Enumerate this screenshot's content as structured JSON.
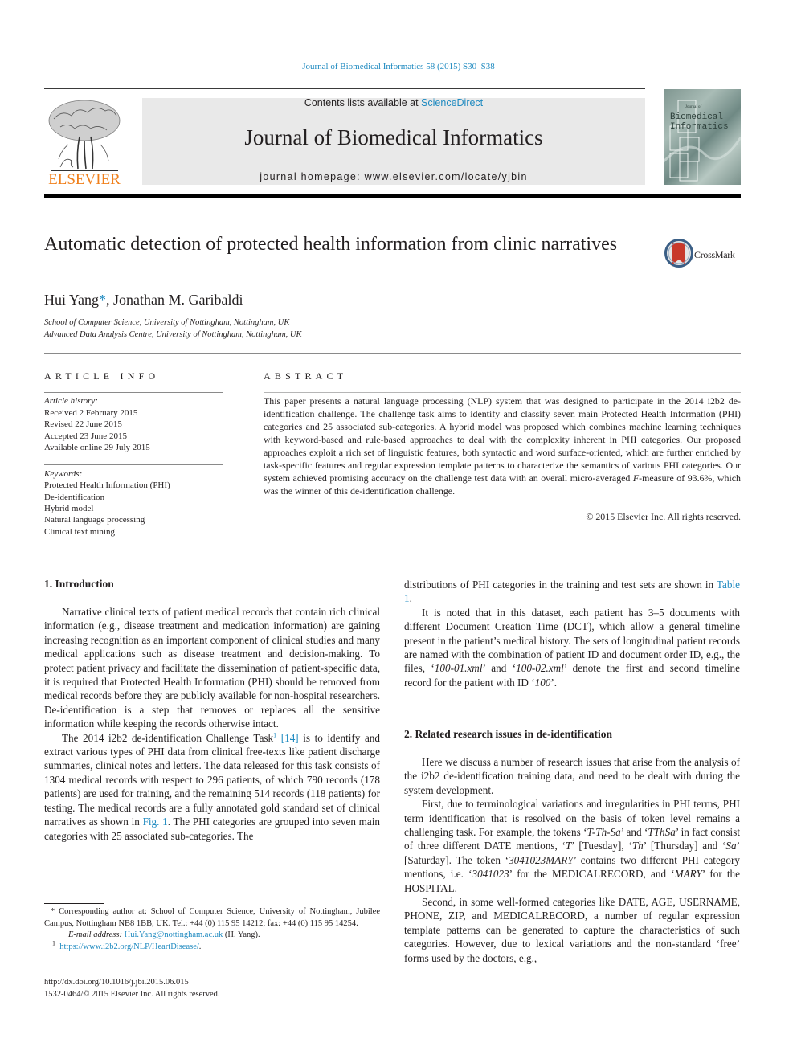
{
  "header": {
    "journal_ref": "Journal of Biomedical Informatics 58 (2015) S30–S38",
    "contents_prefix": "Contents lists available at ",
    "contents_link": "ScienceDirect",
    "journal_title": "Journal of Biomedical Informatics",
    "homepage": "journal homepage: www.elsevier.com/locate/yjbin",
    "publisher_logo_text": "ELSEVIER",
    "cover_title_line1": "Biomedical",
    "cover_title_line2": "Informatics",
    "cover_small": "Journal of",
    "colors": {
      "link": "#1f8ac0",
      "elsevier_orange": "#f07f1a",
      "banner_grey": "#e9e9e9"
    }
  },
  "article": {
    "title": "Automatic detection of protected health information from clinic narratives",
    "crossmark_label": "CrossMark",
    "authors": [
      {
        "name": "Hui Yang",
        "marker": "*"
      },
      {
        "name": "Jonathan M. Garibaldi",
        "marker": ""
      }
    ],
    "author_separator": ", ",
    "affiliations": [
      "School of Computer Science, University of Nottingham, Nottingham, UK",
      "Advanced Data Analysis Centre, University of Nottingham, Nottingham, UK"
    ]
  },
  "article_info": {
    "heading": "ARTICLE INFO",
    "history_label": "Article history:",
    "history": [
      "Received 2 February 2015",
      "Revised 22 June 2015",
      "Accepted 23 June 2015",
      "Available online 29 July 2015"
    ],
    "keywords_label": "Keywords:",
    "keywords": [
      "Protected Health Information (PHI)",
      "De-identification",
      "Hybrid model",
      "Natural language processing",
      "Clinical text mining"
    ]
  },
  "abstract": {
    "heading": "ABSTRACT",
    "text_before_italic": "This paper presents a natural language processing (NLP) system that was designed to participate in the 2014 i2b2 de-identification challenge. The challenge task aims to identify and classify seven main Protected Health Information (PHI) categories and 25 associated sub-categories. A hybrid model was proposed which combines machine learning techniques with keyword-based and rule-based approaches to deal with the complexity inherent in PHI categories. Our proposed approaches exploit a rich set of linguistic features, both syntactic and word surface-oriented, which are further enriched by task-specific features and regular expression template patterns to characterize the semantics of various PHI categories. Our system achieved promising accuracy on the challenge test data with an overall micro-averaged ",
    "italic": "F",
    "text_after_italic": "-measure of 93.6%, which was the winner of this de-identification challenge.",
    "copyright": "© 2015 Elsevier Inc. All rights reserved."
  },
  "section1": {
    "heading": "1. Introduction",
    "p1": "Narrative clinical texts of patient medical records that contain rich clinical information (e.g., disease treatment and medication information) are gaining increasing recognition as an important component of clinical studies and many medical applications such as disease treatment and decision-making. To protect patient privacy and facilitate the dissemination of patient-specific data, it is required that Protected Health Information (PHI) should be removed from medical records before they are publicly available for non-hospital researchers. De-identification is a step that removes or replaces all the sensitive information while keeping the records otherwise intact.",
    "p2_a": "The 2014 i2b2 de-identification Challenge Task",
    "p2_sup": "1",
    "p2_ref": "[14]",
    "p2_b": " is to identify and extract various types of PHI data from clinical free-texts like patient discharge summaries, clinical notes and letters. The data released for this task consists of 1304 medical records with respect to 296 patients, of which 790 records (178 patients) are used for training, and the remaining 514 records (118 patients) for testing. The medical records are a fully annotated gold standard set of clinical narratives as shown in ",
    "p2_fig": "Fig. 1",
    "p2_c": ". The PHI categories are grouped into seven main categories with 25 associated sub-categories. The",
    "p3_a": "distributions of PHI categories in the training and test sets are shown in ",
    "p3_table": "Table 1",
    "p3_b": ".",
    "p4_a": "It is noted that in this dataset, each patient has 3–5 documents with different Document Creation Time (DCT), which allow a general timeline present in the patient’s medical history. The sets of longitudinal patient records are named with the combination of patient ID and document order ID, e.g., the files, ‘",
    "p4_f1": "100-01.xml",
    "p4_b": "’ and ‘",
    "p4_f2": "100-02.xml",
    "p4_c": "’ denote the first and second timeline record for the patient with ID ‘",
    "p4_id": "100",
    "p4_d": "’."
  },
  "section2": {
    "heading": "2. Related research issues in de-identification",
    "p1": "Here we discuss a number of research issues that arise from the analysis of the i2b2 de-identification training data, and need to be dealt with during the system development.",
    "p2_a": "First, due to terminological variations and irregularities in PHI terms, PHI term identification that is resolved on the basis of token level remains a challenging task. For example, the tokens ‘",
    "p2_t1": "T-Th-Sa",
    "p2_b": "’ and ‘",
    "p2_t2": "TThSa",
    "p2_c": "’ in fact consist of three different DATE mentions, ‘",
    "p2_t3": "T",
    "p2_d": "’ [Tuesday], ‘",
    "p2_t4": "Th",
    "p2_e": "’ [Thursday] and ‘",
    "p2_t5": "Sa",
    "p2_f": "’ [Saturday]. The token ‘",
    "p2_t6": "3041023MARY",
    "p2_g": "’ contains two different PHI category mentions, i.e. ‘",
    "p2_t7": "3041023",
    "p2_h": "’ for the MEDICALRECORD, and ‘",
    "p2_t8": "MARY",
    "p2_i": "’ for the HOSPITAL.",
    "p3": "Second, in some well-formed categories like DATE, AGE, USERNAME, PHONE, ZIP, and MEDICALRECORD, a number of regular expression template patterns can be generated to capture the characteristics of such categories. However, due to lexical variations and the non-standard ‘free’ forms used by the doctors, e.g.,"
  },
  "footnotes": {
    "corresponding": "* Corresponding author at: School of Computer Science, University of Nottingham, Jubilee Campus, Nottingham NB8 1BB, UK. Tel.: +44 (0) 115 95 14212; fax: +44 (0) 115 95 14254.",
    "email_label": "E-mail address:",
    "email": "Hui.Yang@nottingham.ac.uk",
    "email_suffix": " (H. Yang).",
    "fn1_marker": "1",
    "fn1_url": "https://www.i2b2.org/NLP/HeartDisease/",
    "fn1_suffix": ".",
    "doi": "http://dx.doi.org/10.1016/j.jbi.2015.06.015",
    "issn": "1532-0464/© 2015 Elsevier Inc. All rights reserved."
  }
}
